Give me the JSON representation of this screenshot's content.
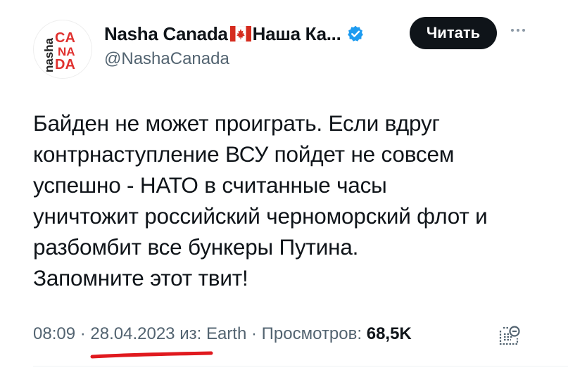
{
  "account": {
    "display_name": "Nasha Canada",
    "display_name_suffix": "Наша Ка...",
    "handle": "@NashaCanada",
    "avatar_text": {
      "brand_vertical": "nasha",
      "row1": "CA",
      "row2": "NA",
      "row3": "DA"
    },
    "verified": true
  },
  "follow_button": {
    "label": "Читать"
  },
  "tweet": {
    "lines": [
      "Байден не может проиграть. Если вдруг",
      "контрнаступление ВСУ пойдет не совсем",
      "успешно - НАТО в считанные часы",
      "уничтожит российский черноморский флот и",
      "разбомбит все бункеры Путина.",
      "Запомните этот твит!"
    ]
  },
  "meta": {
    "time": "08:09",
    "separator": "·",
    "date": "28.04.2023",
    "source_prefix": "из:",
    "source": "Earth",
    "views_label": "Просмотров:",
    "views_count": "68,5K"
  },
  "colors": {
    "accent_red": "#e0312f",
    "verified_blue": "#1d9bf0",
    "muted_text": "#536471",
    "primary_text": "#0f1419",
    "annotation_red": "#e0191e"
  },
  "icons": {
    "verified": "verified-badge-icon",
    "flag": "canada-flag-icon",
    "more": "more-icon",
    "analytics": "analytics-icon"
  }
}
